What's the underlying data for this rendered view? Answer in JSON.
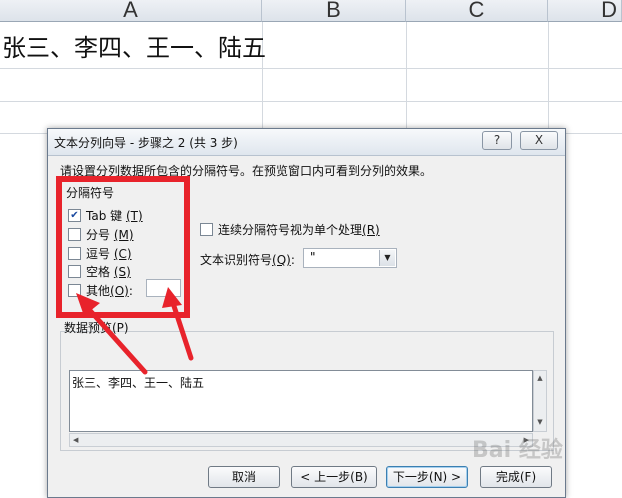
{
  "sheet": {
    "columns": [
      "A",
      "B",
      "C",
      "D"
    ],
    "cell_a1": "张三、李四、王一、陆五"
  },
  "dialog": {
    "title": "文本分列向导 - 步骤之 2 (共 3 步)",
    "help_label": "?",
    "close_label": "X",
    "description": "请设置分列数据所包含的分隔符号。在预览窗口内可看到分列的效果。",
    "delimiters": {
      "group_label": "分隔符号",
      "tab": {
        "label": "Tab 键",
        "key": "(T)",
        "checked": true
      },
      "semicolon": {
        "label": "分号",
        "key": "(M)",
        "checked": false
      },
      "comma": {
        "label": "逗号",
        "key": "(C)",
        "checked": false
      },
      "space": {
        "label": "空格",
        "key": "(S)",
        "checked": false
      },
      "other": {
        "label": "其他",
        "key": "(O)",
        "suffix": ":",
        "checked": false,
        "value": ""
      }
    },
    "consecutive": {
      "label": "连续分隔符号视为单个处理",
      "key": "(R)",
      "checked": false
    },
    "text_qualifier": {
      "label": "文本识别符号",
      "key": "(Q)",
      "suffix": ":",
      "value": "\""
    },
    "preview": {
      "label": "数据预览(P)",
      "line": "张三、李四、王一、陆五"
    },
    "buttons": {
      "cancel": "取消",
      "back": "< 上一步(B)",
      "next": "下一步(N) >",
      "finish": "完成(F)"
    }
  },
  "annotation": {
    "color": "#e8232b"
  },
  "watermark": "Bai 经验"
}
